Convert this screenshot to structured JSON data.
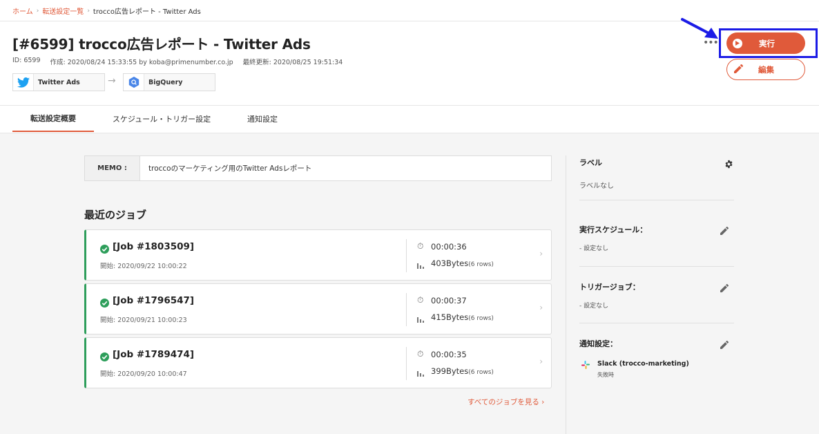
{
  "breadcrumb": {
    "home": "ホーム",
    "list": "転送設定一覧",
    "current": "trocco広告レポート - Twitter Ads"
  },
  "header": {
    "title": "[#6599] trocco広告レポート - Twitter Ads",
    "id": "ID: 6599",
    "created": "作成: 2020/08/24 15:33:55 by koba@primenumber.co.jp",
    "updated": "最終更新: 2020/08/25 19:51:34",
    "source": "Twitter Ads",
    "destination": "BigQuery",
    "run_label": "実行",
    "edit_label": "編集",
    "more": "•••"
  },
  "tabs": [
    {
      "label": "転送設定概要",
      "active": true
    },
    {
      "label": "スケジュール・トリガー設定",
      "active": false
    },
    {
      "label": "通知設定",
      "active": false
    }
  ],
  "memo": {
    "label": "MEMO :",
    "text": "troccoのマーケティング用のTwitter Adsレポート"
  },
  "jobs": {
    "title": "最近のジョブ",
    "items": [
      {
        "title": "[Job #1803509]",
        "start": "開始: 2020/09/22 10:00:22",
        "duration": "00:00:36",
        "bytes": "403Bytes",
        "rows": "(6 rows)"
      },
      {
        "title": "[Job #1796547]",
        "start": "開始: 2020/09/21 10:00:23",
        "duration": "00:00:37",
        "bytes": "415Bytes",
        "rows": "(6 rows)"
      },
      {
        "title": "[Job #1789474]",
        "start": "開始: 2020/09/20 10:00:47",
        "duration": "00:00:35",
        "bytes": "399Bytes",
        "rows": "(6 rows)"
      }
    ],
    "see_all": "すべてのジョブを見る  ›"
  },
  "sidebar": {
    "label_title": "ラベル",
    "label_value": "ラベルなし",
    "schedule_title": "実行スケジュール：",
    "schedule_value": "- 設定なし",
    "trigger_title": "トリガージョブ：",
    "trigger_value": "- 設定なし",
    "notify_title": "通知設定：",
    "notify_name": "Slack (trocco-marketing)",
    "notify_sub": "失敗時"
  },
  "colors": {
    "accent": "#e05a3a",
    "success": "#2e9e5b",
    "highlight": "#1b1be6",
    "twitter": "#1da1f2",
    "bigquery": "#4a86e8"
  }
}
